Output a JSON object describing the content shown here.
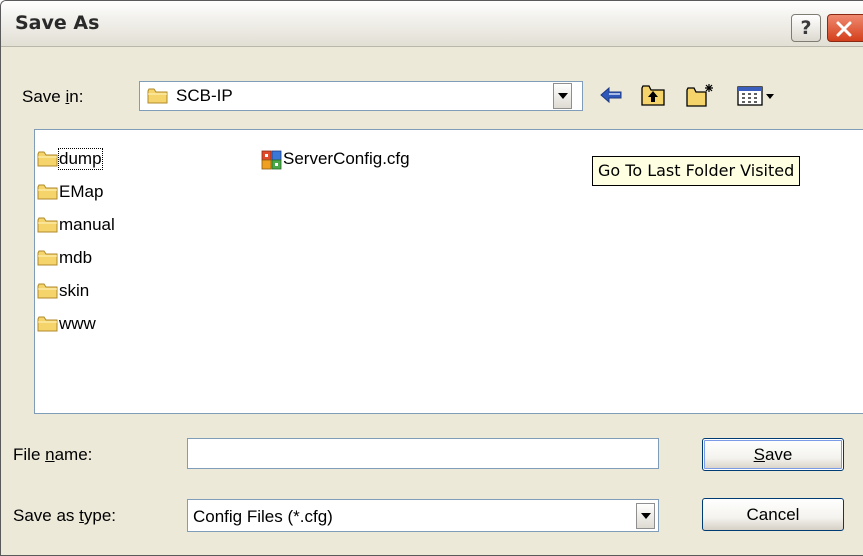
{
  "window": {
    "title": "Save As"
  },
  "title_buttons": {
    "help_label": "?"
  },
  "save_in": {
    "label_pre": "Save ",
    "label_accel": "i",
    "label_post": "n:",
    "value": "SCB-IP"
  },
  "toolbar": {
    "icons": [
      "back-arrow-icon",
      "up-one-level-icon",
      "new-folder-icon",
      "view-menu-icon"
    ]
  },
  "files": [
    {
      "name": "dump",
      "type": "folder",
      "focused": true
    },
    {
      "name": "EMap",
      "type": "folder"
    },
    {
      "name": "manual",
      "type": "folder"
    },
    {
      "name": "mdb",
      "type": "folder"
    },
    {
      "name": "skin",
      "type": "folder"
    },
    {
      "name": "www",
      "type": "folder"
    },
    {
      "name": "ServerConfig.cfg",
      "type": "cfg-file"
    }
  ],
  "tooltip": {
    "text": "Go To Last Folder Visited"
  },
  "file_name": {
    "label_pre": "File ",
    "label_accel": "n",
    "label_post": "ame:",
    "value": ""
  },
  "save_as_type": {
    "label_pre": "Save as ",
    "label_accel": "t",
    "label_post": "ype:",
    "value": "Config Files (*.cfg)"
  },
  "buttons": {
    "save_accel": "S",
    "save_rest": "ave",
    "cancel": "Cancel"
  },
  "colors": {
    "dialog_bg": "#ece9d8",
    "field_border": "#7f9db9",
    "folder_yellow": "#f5d46b",
    "tooltip_bg": "#ffffe1",
    "close_red": "#d33f1b"
  }
}
